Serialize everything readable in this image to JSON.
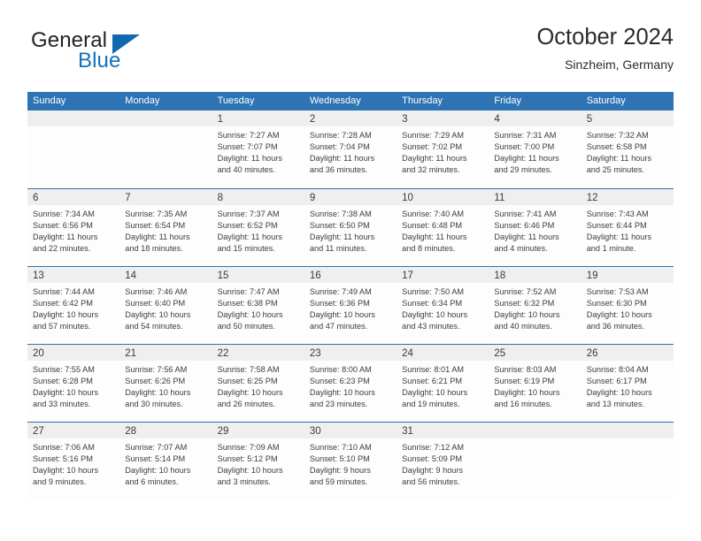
{
  "brand": {
    "word1": "General",
    "word2": "Blue",
    "triangle_icon": "triangle-logo-icon",
    "color_dark": "#231f20",
    "color_blue": "#1172ba"
  },
  "header": {
    "title": "October 2024",
    "subtitle": "Sinzheim, Germany"
  },
  "theme": {
    "header_blue": "#2e74b5",
    "day_band_gray": "#efefef",
    "cell_bg": "#fdfdfd",
    "text": "#3d3d3d"
  },
  "weekdays": [
    "Sunday",
    "Monday",
    "Tuesday",
    "Wednesday",
    "Thursday",
    "Friday",
    "Saturday"
  ],
  "weeks": [
    [
      {
        "day": "",
        "lines": []
      },
      {
        "day": "",
        "lines": []
      },
      {
        "day": "1",
        "lines": [
          "Sunrise: 7:27 AM",
          "Sunset: 7:07 PM",
          "Daylight: 11 hours",
          "and 40 minutes."
        ]
      },
      {
        "day": "2",
        "lines": [
          "Sunrise: 7:28 AM",
          "Sunset: 7:04 PM",
          "Daylight: 11 hours",
          "and 36 minutes."
        ]
      },
      {
        "day": "3",
        "lines": [
          "Sunrise: 7:29 AM",
          "Sunset: 7:02 PM",
          "Daylight: 11 hours",
          "and 32 minutes."
        ]
      },
      {
        "day": "4",
        "lines": [
          "Sunrise: 7:31 AM",
          "Sunset: 7:00 PM",
          "Daylight: 11 hours",
          "and 29 minutes."
        ]
      },
      {
        "day": "5",
        "lines": [
          "Sunrise: 7:32 AM",
          "Sunset: 6:58 PM",
          "Daylight: 11 hours",
          "and 25 minutes."
        ]
      }
    ],
    [
      {
        "day": "6",
        "lines": [
          "Sunrise: 7:34 AM",
          "Sunset: 6:56 PM",
          "Daylight: 11 hours",
          "and 22 minutes."
        ]
      },
      {
        "day": "7",
        "lines": [
          "Sunrise: 7:35 AM",
          "Sunset: 6:54 PM",
          "Daylight: 11 hours",
          "and 18 minutes."
        ]
      },
      {
        "day": "8",
        "lines": [
          "Sunrise: 7:37 AM",
          "Sunset: 6:52 PM",
          "Daylight: 11 hours",
          "and 15 minutes."
        ]
      },
      {
        "day": "9",
        "lines": [
          "Sunrise: 7:38 AM",
          "Sunset: 6:50 PM",
          "Daylight: 11 hours",
          "and 11 minutes."
        ]
      },
      {
        "day": "10",
        "lines": [
          "Sunrise: 7:40 AM",
          "Sunset: 6:48 PM",
          "Daylight: 11 hours",
          "and 8 minutes."
        ]
      },
      {
        "day": "11",
        "lines": [
          "Sunrise: 7:41 AM",
          "Sunset: 6:46 PM",
          "Daylight: 11 hours",
          "and 4 minutes."
        ]
      },
      {
        "day": "12",
        "lines": [
          "Sunrise: 7:43 AM",
          "Sunset: 6:44 PM",
          "Daylight: 11 hours",
          "and 1 minute."
        ]
      }
    ],
    [
      {
        "day": "13",
        "lines": [
          "Sunrise: 7:44 AM",
          "Sunset: 6:42 PM",
          "Daylight: 10 hours",
          "and 57 minutes."
        ]
      },
      {
        "day": "14",
        "lines": [
          "Sunrise: 7:46 AM",
          "Sunset: 6:40 PM",
          "Daylight: 10 hours",
          "and 54 minutes."
        ]
      },
      {
        "day": "15",
        "lines": [
          "Sunrise: 7:47 AM",
          "Sunset: 6:38 PM",
          "Daylight: 10 hours",
          "and 50 minutes."
        ]
      },
      {
        "day": "16",
        "lines": [
          "Sunrise: 7:49 AM",
          "Sunset: 6:36 PM",
          "Daylight: 10 hours",
          "and 47 minutes."
        ]
      },
      {
        "day": "17",
        "lines": [
          "Sunrise: 7:50 AM",
          "Sunset: 6:34 PM",
          "Daylight: 10 hours",
          "and 43 minutes."
        ]
      },
      {
        "day": "18",
        "lines": [
          "Sunrise: 7:52 AM",
          "Sunset: 6:32 PM",
          "Daylight: 10 hours",
          "and 40 minutes."
        ]
      },
      {
        "day": "19",
        "lines": [
          "Sunrise: 7:53 AM",
          "Sunset: 6:30 PM",
          "Daylight: 10 hours",
          "and 36 minutes."
        ]
      }
    ],
    [
      {
        "day": "20",
        "lines": [
          "Sunrise: 7:55 AM",
          "Sunset: 6:28 PM",
          "Daylight: 10 hours",
          "and 33 minutes."
        ]
      },
      {
        "day": "21",
        "lines": [
          "Sunrise: 7:56 AM",
          "Sunset: 6:26 PM",
          "Daylight: 10 hours",
          "and 30 minutes."
        ]
      },
      {
        "day": "22",
        "lines": [
          "Sunrise: 7:58 AM",
          "Sunset: 6:25 PM",
          "Daylight: 10 hours",
          "and 26 minutes."
        ]
      },
      {
        "day": "23",
        "lines": [
          "Sunrise: 8:00 AM",
          "Sunset: 6:23 PM",
          "Daylight: 10 hours",
          "and 23 minutes."
        ]
      },
      {
        "day": "24",
        "lines": [
          "Sunrise: 8:01 AM",
          "Sunset: 6:21 PM",
          "Daylight: 10 hours",
          "and 19 minutes."
        ]
      },
      {
        "day": "25",
        "lines": [
          "Sunrise: 8:03 AM",
          "Sunset: 6:19 PM",
          "Daylight: 10 hours",
          "and 16 minutes."
        ]
      },
      {
        "day": "26",
        "lines": [
          "Sunrise: 8:04 AM",
          "Sunset: 6:17 PM",
          "Daylight: 10 hours",
          "and 13 minutes."
        ]
      }
    ],
    [
      {
        "day": "27",
        "lines": [
          "Sunrise: 7:06 AM",
          "Sunset: 5:16 PM",
          "Daylight: 10 hours",
          "and 9 minutes."
        ]
      },
      {
        "day": "28",
        "lines": [
          "Sunrise: 7:07 AM",
          "Sunset: 5:14 PM",
          "Daylight: 10 hours",
          "and 6 minutes."
        ]
      },
      {
        "day": "29",
        "lines": [
          "Sunrise: 7:09 AM",
          "Sunset: 5:12 PM",
          "Daylight: 10 hours",
          "and 3 minutes."
        ]
      },
      {
        "day": "30",
        "lines": [
          "Sunrise: 7:10 AM",
          "Sunset: 5:10 PM",
          "Daylight: 9 hours",
          "and 59 minutes."
        ]
      },
      {
        "day": "31",
        "lines": [
          "Sunrise: 7:12 AM",
          "Sunset: 5:09 PM",
          "Daylight: 9 hours",
          "and 56 minutes."
        ]
      },
      {
        "day": "",
        "lines": []
      },
      {
        "day": "",
        "lines": []
      }
    ]
  ]
}
